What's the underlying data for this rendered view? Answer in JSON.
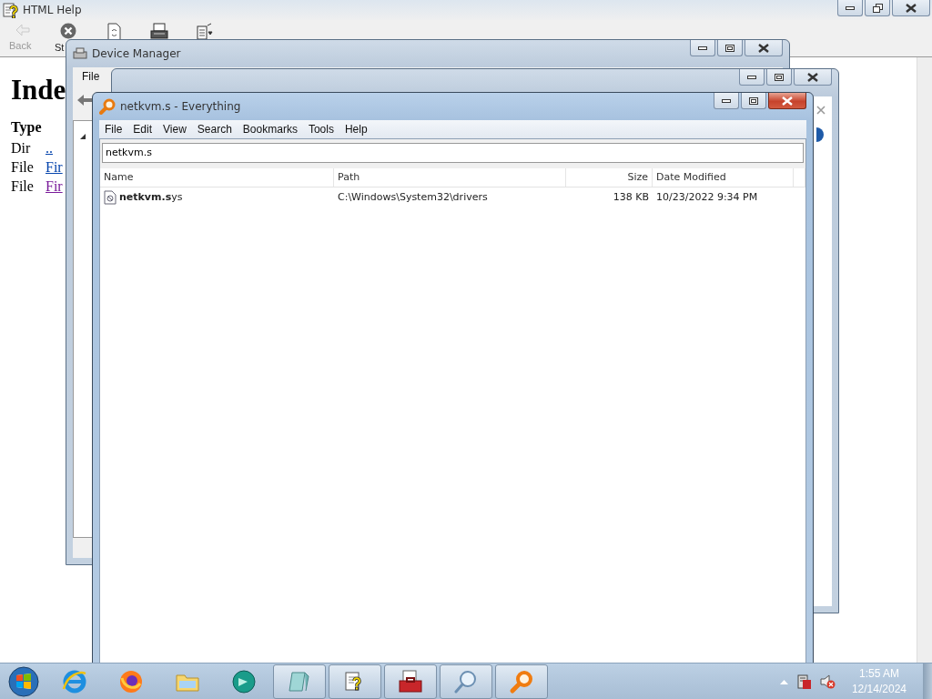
{
  "help_window": {
    "title": "HTML Help",
    "active": false,
    "maximized": true,
    "toolbar": [
      {
        "kind": "back",
        "label": "Back",
        "disabled": true
      },
      {
        "kind": "stop",
        "label": "St",
        "disabled": false
      },
      {
        "kind": "refresh",
        "disabled": false
      },
      {
        "kind": "print",
        "disabled": false
      },
      {
        "kind": "options",
        "disabled": false
      }
    ],
    "heading": "Inde",
    "table": {
      "columns": [
        "Type"
      ],
      "rows": [
        {
          "type": "Dir",
          "link": "..",
          "visited": false
        },
        {
          "type": "File",
          "link": "Fir",
          "visited": false
        },
        {
          "type": "File",
          "link": "Fir",
          "visited": true
        }
      ]
    }
  },
  "device_manager": {
    "title": "Device Manager",
    "active": false,
    "menu": [
      "File"
    ]
  },
  "background_window": {
    "active": false
  },
  "everything": {
    "title": "netkvm.s - Everything",
    "active": true,
    "menu": [
      "File",
      "Edit",
      "View",
      "Search",
      "Bookmarks",
      "Tools",
      "Help"
    ],
    "search": {
      "value": "netkvm.s"
    },
    "columns": [
      "Name",
      "Path",
      "Size",
      "Date Modified"
    ],
    "rows": [
      {
        "name": "**netkvm.s**ys",
        "path": "C:\\Windows\\System32\\drivers",
        "size": "138 KB",
        "date_modified": "10/23/2022 9:34 PM",
        "selected": false
      }
    ]
  },
  "taskbar": {
    "items": [
      {
        "kind": "pinned"
      },
      {
        "kind": "pinned"
      },
      {
        "kind": "pinned"
      },
      {
        "kind": "pinned"
      },
      {
        "kind": "running"
      },
      {
        "kind": "running"
      },
      {
        "kind": "running"
      },
      {
        "kind": "running"
      },
      {
        "kind": "running"
      }
    ],
    "tray": {
      "network_error": true,
      "volume_muted": true
    },
    "time": "1:55 AM",
    "date": "12/14/2024"
  }
}
